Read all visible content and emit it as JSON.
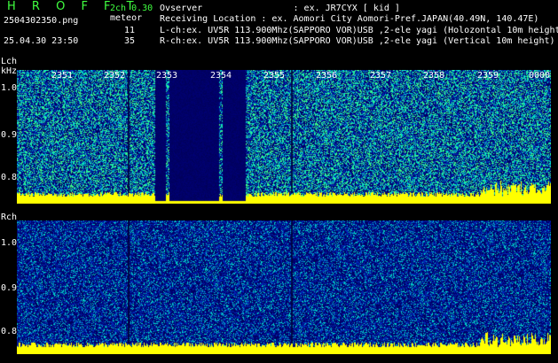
{
  "header": {
    "app_name": "H R O F F T",
    "mode": "2ch 0.30",
    "filename": "2504302350.png",
    "meteor_label": "meteor",
    "lch_count": "11",
    "datetime": "25.04.30 23:50",
    "rch_count": "35"
  },
  "info": {
    "observer": "Ovserver                 : ex. JR7CYX [ kid ]",
    "location": "Receiving Location : ex. Aomori City Aomori-Pref.JAPAN(40.49N, 140.47E)",
    "lch": "L-ch:ex. UV5R 113.900Mhz(SAPPORO VOR)USB ,2-ele yagi (Holozontal 10m height)",
    "rch": "R-ch:ex. UV5R 113.900Mhz(SAPPORO VOR)USB ,2-ele yagi (Vertical 10m height)"
  },
  "lch_panel": {
    "label": "Lch",
    "unit": "kHz",
    "y_ticks": [
      "1.0",
      "0.9",
      "0.8"
    ],
    "time_ticks": [
      "2351",
      "2352",
      "2353",
      "2354",
      "2355",
      "2356",
      "2357",
      "2358",
      "2359",
      "0000"
    ]
  },
  "rch_panel": {
    "label": "Rch",
    "y_ticks": [
      "1.0",
      "0.9",
      "0.8"
    ]
  },
  "colors": {
    "title": "#40ff40",
    "trace": "#ffff00",
    "noise_high": "#40ff80",
    "noise_low": "#0000a0"
  }
}
